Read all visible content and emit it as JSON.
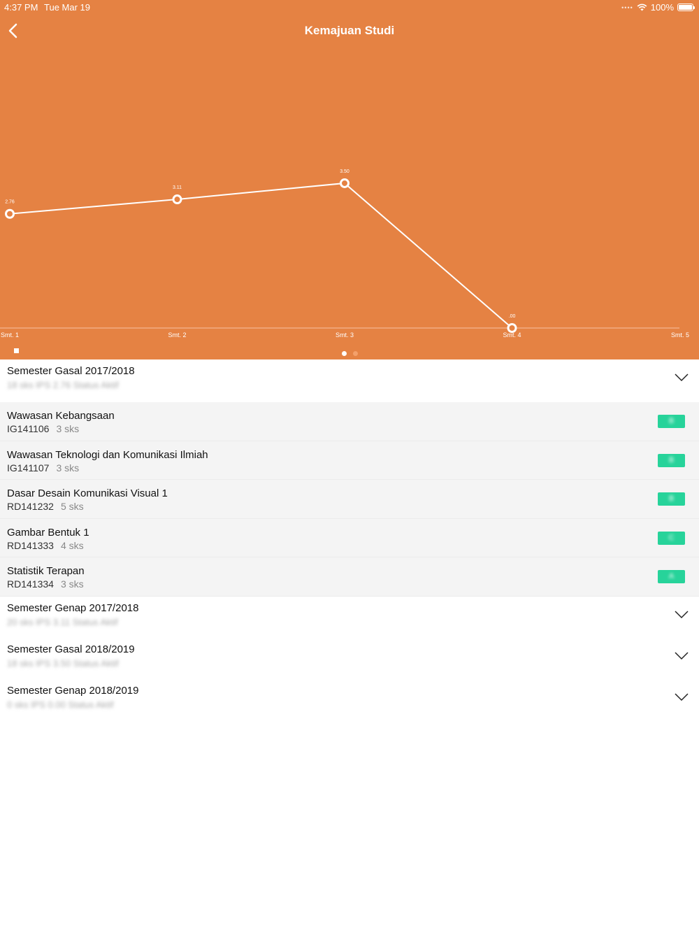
{
  "status_bar": {
    "time": "4:37 PM",
    "date": "Tue Mar 19",
    "battery": "100%"
  },
  "nav": {
    "title": "Kemajuan Studi"
  },
  "colors": {
    "header": "#E58243",
    "grade": "#27D39A",
    "dot_active": "#ffffff",
    "dot_inactive": "#F4A06A"
  },
  "chart_data": {
    "type": "line",
    "categories": [
      "Smt. 1",
      "Smt. 2",
      "Smt. 3",
      "Smt. 4",
      "Smt. 5"
    ],
    "series": [
      {
        "values": [
          2.76,
          3.11,
          3.5,
          0.0
        ],
        "labels": [
          "2.76",
          "3.11",
          "3.50",
          ".00"
        ]
      }
    ],
    "ylim": [
      0,
      5.9
    ],
    "grid": false,
    "legend": "bottom-left"
  },
  "semesters": [
    {
      "title": "Semester Gasal 2017/2018",
      "subtitle": "18 sks  IPS 2.76  Status Aktif",
      "courses": [
        {
          "name": "Wawasan Kebangsaan",
          "code": "IG141106",
          "sks": "3 sks",
          "grade": "B"
        },
        {
          "name": "Wawasan Teknologi dan Komunikasi Ilmiah",
          "code": "IG141107",
          "sks": "3 sks",
          "grade": "B"
        },
        {
          "name": "Dasar Desain Komunikasi Visual 1",
          "code": "RD141232",
          "sks": "5 sks",
          "grade": "B"
        },
        {
          "name": "Gambar Bentuk 1",
          "code": "RD141333",
          "sks": "4 sks",
          "grade": "C"
        },
        {
          "name": "Statistik Terapan",
          "code": "RD141334",
          "sks": "3 sks",
          "grade": "A"
        }
      ]
    },
    {
      "title": "Semester Genap 2017/2018",
      "subtitle": "20 sks  IPS 3.11  Status Aktif"
    },
    {
      "title": "Semester Gasal 2018/2019",
      "subtitle": "18 sks  IPS 3.50  Status Aktif"
    },
    {
      "title": "Semester Genap 2018/2019",
      "subtitle": "0 sks  IPS 0.00  Status Aktif"
    }
  ]
}
